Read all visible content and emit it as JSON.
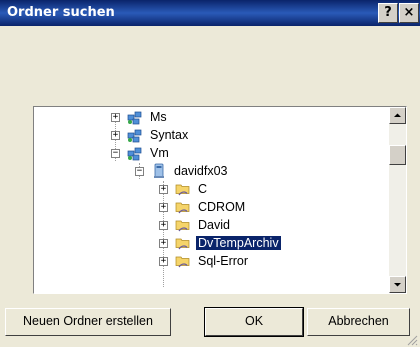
{
  "window": {
    "title": "Ordner suchen",
    "help_label": "?",
    "close_label": "×"
  },
  "tree": {
    "items": [
      {
        "label": "Ms",
        "expander": "+",
        "icon": "network-workgroup-icon"
      },
      {
        "label": "Syntax",
        "expander": "+",
        "icon": "network-workgroup-icon"
      },
      {
        "label": "Vm",
        "expander": "−",
        "icon": "network-workgroup-icon"
      },
      {
        "label": "davidfx03",
        "expander": "−",
        "icon": "computer-icon"
      },
      {
        "label": "C",
        "expander": "+",
        "icon": "shared-folder-icon"
      },
      {
        "label": "CDROM",
        "expander": "+",
        "icon": "shared-folder-icon"
      },
      {
        "label": "David",
        "expander": "+",
        "icon": "shared-folder-icon"
      },
      {
        "label": "DvTempArchiv",
        "expander": "+",
        "icon": "shared-folder-icon",
        "selected": true
      },
      {
        "label": "Sql-Error",
        "expander": "+",
        "icon": "shared-folder-icon"
      }
    ]
  },
  "buttons": {
    "new_folder": "Neuen Ordner erstellen",
    "ok": "OK",
    "cancel": "Abbrechen"
  },
  "colors": {
    "titlebar": "#0a246a",
    "selection": "#0a246a",
    "dialog_bg": "#ece9d8"
  }
}
